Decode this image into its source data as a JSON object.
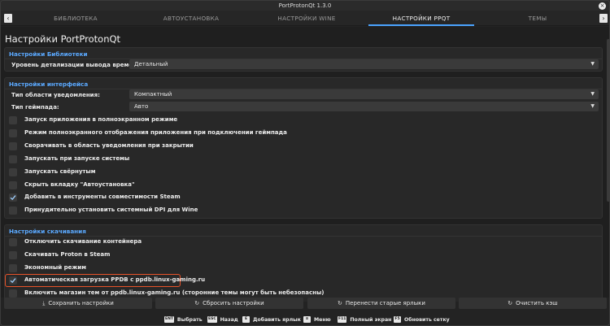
{
  "window": {
    "title": "PortProtonQt 1.3.0"
  },
  "tabs": [
    {
      "label": "БИБЛИОТЕКА"
    },
    {
      "label": "АВТОУСТАНОВКА"
    },
    {
      "label": "НАСТРОЙКИ WINE"
    },
    {
      "label": "НАСТРОЙКИ PPQT"
    },
    {
      "label": "ТЕМЫ"
    }
  ],
  "page": {
    "title": "Настройки PortProtonQt"
  },
  "library": {
    "section_title": "Настройки Библиотеки",
    "time_detail_label": "Уровень детализации вывода времени:",
    "time_detail_value": "Детальный"
  },
  "interface": {
    "section_title": "Настройки интерфейса",
    "tray_label": "Тип области уведомления:",
    "tray_value": "Компактный",
    "gamepad_label": "Тип геймпада:",
    "gamepad_value": "Авто",
    "options": [
      {
        "label": "Запуск приложения в полноэкранном режиме",
        "checked": false
      },
      {
        "label": "Режим полноэкранного отображения приложения при подключении геймпада",
        "checked": false
      },
      {
        "label": "Сворачивать в область уведомления при закрытии",
        "checked": false
      },
      {
        "label": "Запускать при запуске системы",
        "checked": false
      },
      {
        "label": "Запускать свёрнутым",
        "checked": false
      },
      {
        "label": "Скрыть вкладку \"Автоустановка\"",
        "checked": false
      },
      {
        "label": "Добавить в инструменты совместимости Steam",
        "checked": true
      },
      {
        "label": "Принудительно установить системный DPI для Wine",
        "checked": false
      }
    ]
  },
  "downloads": {
    "section_title": "Настройки скачивания",
    "options": [
      {
        "label": "Отключить скачивание контейнера",
        "checked": false
      },
      {
        "label": "Скачивать Proton в Steam",
        "checked": false
      },
      {
        "label": "Экономный режим",
        "checked": false
      },
      {
        "label": "Автоматическая загрузка PPDB с ppdb.linux-gaming.ru",
        "checked": true
      },
      {
        "label": "Включить магазин тем от ppdb.linux-gaming.ru (сторонние темы могут быть небезопасны)",
        "checked": false
      }
    ]
  },
  "actions": {
    "save": "Сохранить настройки",
    "reset": "Сбросить настройки",
    "migrate": "Перенести старые ярлыки",
    "clear_cache": "Очистить кэш"
  },
  "hints": [
    {
      "key": "ENT",
      "label": "Выбрать"
    },
    {
      "key": "ESC",
      "label": "Назад"
    },
    {
      "key": "E",
      "label": "Добавить ярлык"
    },
    {
      "key": "≡",
      "label": "Меню"
    },
    {
      "key": "F11",
      "label": "Полный экран"
    },
    {
      "key": "F5",
      "label": "Обновить сетку"
    }
  ],
  "colors": {
    "accent": "#4aa3ff",
    "highlight": "#e8532a",
    "section": "#5ba9ff"
  }
}
